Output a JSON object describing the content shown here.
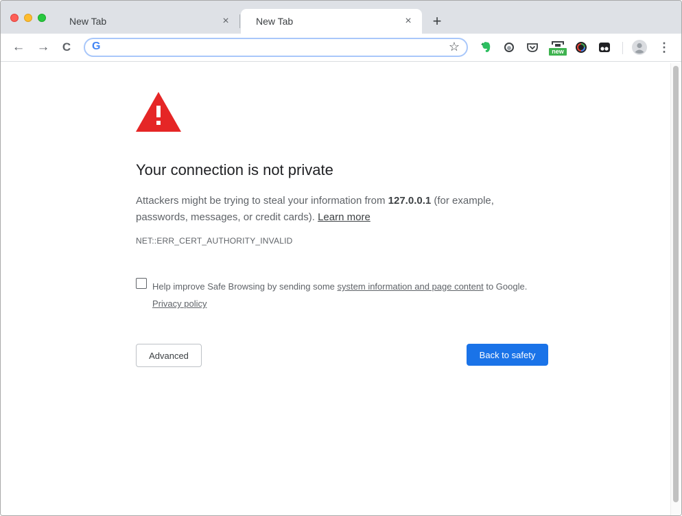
{
  "tabs": [
    {
      "label": "New Tab",
      "active": false
    },
    {
      "label": "New Tab",
      "active": true
    }
  ],
  "icons": {
    "tab_close": "×",
    "new_tab": "+",
    "back": "←",
    "forward": "→",
    "reload": "C",
    "google": "G",
    "star": "☆",
    "menu": "⋮"
  },
  "omnibox": {
    "value": "",
    "placeholder": ""
  },
  "extensions": {
    "screenshot_badge": "new"
  },
  "interstitial": {
    "heading": "Your connection is not private",
    "explanation_pre": "Attackers might be trying to steal your information from ",
    "host": "127.0.0.1",
    "explanation_post": " (for example, passwords, messages, or credit cards). ",
    "learn_more": "Learn more",
    "error_code": "NET::ERR_CERT_AUTHORITY_INVALID",
    "safe_browsing_pre": "Help improve Safe Browsing by sending some ",
    "safe_browsing_link": "system information and page content",
    "safe_browsing_post": " to Google.",
    "privacy_policy": "Privacy policy",
    "advanced_button": "Advanced",
    "back_button": "Back to safety",
    "warning_icon_text": "!"
  },
  "colors": {
    "warning_red": "#e52626",
    "primary_button": "#1a73e8",
    "tabstrip": "#dee1e6"
  }
}
